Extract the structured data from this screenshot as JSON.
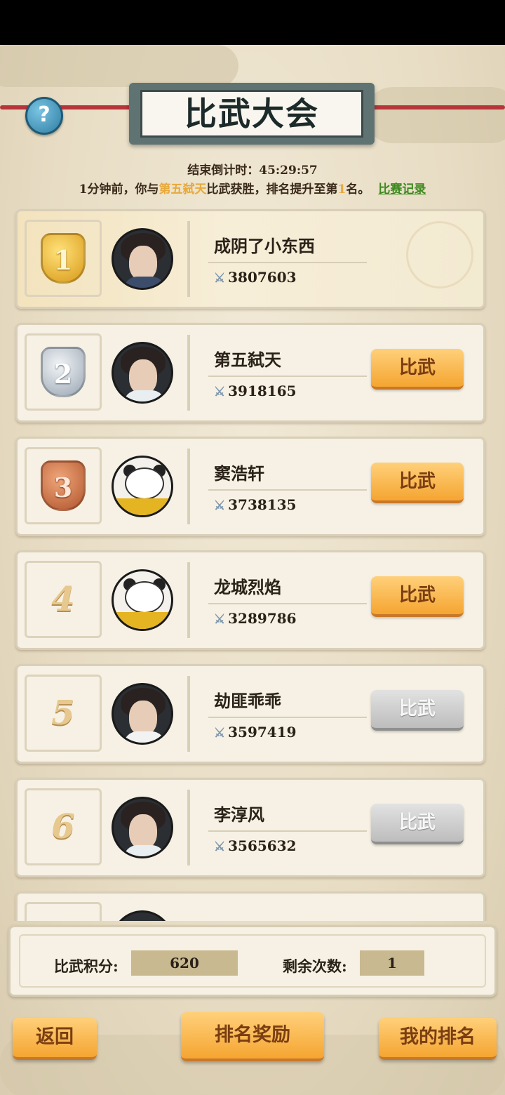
{
  "header": {
    "help_label": "?",
    "title": "比武大会",
    "countdown_label": "结束倒计时：",
    "countdown_value": "45:29:57"
  },
  "message": {
    "part1": "1分钟前，你与",
    "opponent": "第五弑天",
    "part2": "比武获胜，排名提升至第",
    "rank": "1",
    "part3": "名。",
    "record_link": "比赛记录"
  },
  "players": [
    {
      "rank": "1",
      "name": "成阴了小东西",
      "power": "3807603",
      "button": ""
    },
    {
      "rank": "2",
      "name": "第五弑天",
      "power": "3918165",
      "button": "比武"
    },
    {
      "rank": "3",
      "name": "窦浩轩",
      "power": "3738135",
      "button": "比武"
    },
    {
      "rank": "4",
      "name": "龙城烈焰",
      "power": "3289786",
      "button": "比武"
    },
    {
      "rank": "5",
      "name": "劫匪乖乖",
      "power": "3597419",
      "button": "比武"
    },
    {
      "rank": "6",
      "name": "李淳风",
      "power": "3565632",
      "button": "比武"
    }
  ],
  "footer": {
    "score_label": "比武积分:",
    "score_value": "620",
    "remaining_label": "剩余次数:",
    "remaining_value": "1",
    "back_label": "返回",
    "rewards_label": "排名奖励",
    "my_rank_label": "我的排名"
  },
  "colors": {
    "button_orange": "#f5a531",
    "button_disabled": "#bdbdbd",
    "highlight": "#e8a93b",
    "link_green": "#3c8a1e"
  }
}
